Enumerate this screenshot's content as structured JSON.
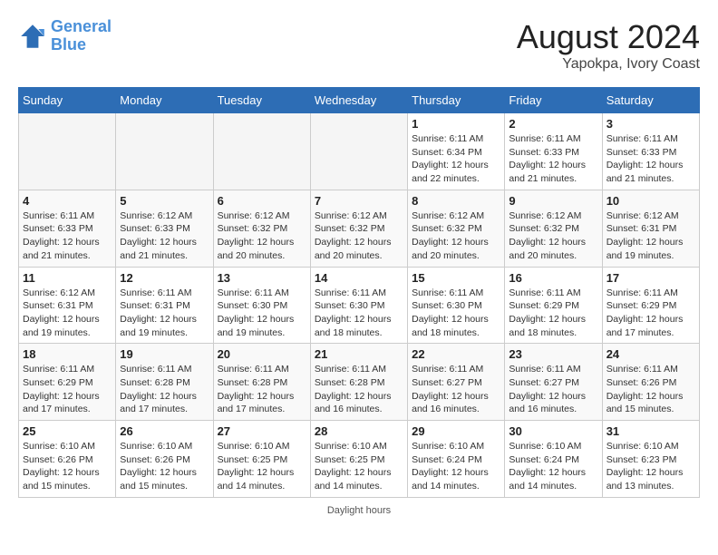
{
  "header": {
    "logo_line1": "General",
    "logo_line2": "Blue",
    "month": "August 2024",
    "location": "Yapokpa, Ivory Coast"
  },
  "days_of_week": [
    "Sunday",
    "Monday",
    "Tuesday",
    "Wednesday",
    "Thursday",
    "Friday",
    "Saturday"
  ],
  "weeks": [
    [
      {
        "day": "",
        "info": ""
      },
      {
        "day": "",
        "info": ""
      },
      {
        "day": "",
        "info": ""
      },
      {
        "day": "",
        "info": ""
      },
      {
        "day": "1",
        "info": "Sunrise: 6:11 AM\nSunset: 6:34 PM\nDaylight: 12 hours\nand 22 minutes."
      },
      {
        "day": "2",
        "info": "Sunrise: 6:11 AM\nSunset: 6:33 PM\nDaylight: 12 hours\nand 21 minutes."
      },
      {
        "day": "3",
        "info": "Sunrise: 6:11 AM\nSunset: 6:33 PM\nDaylight: 12 hours\nand 21 minutes."
      }
    ],
    [
      {
        "day": "4",
        "info": "Sunrise: 6:11 AM\nSunset: 6:33 PM\nDaylight: 12 hours\nand 21 minutes."
      },
      {
        "day": "5",
        "info": "Sunrise: 6:12 AM\nSunset: 6:33 PM\nDaylight: 12 hours\nand 21 minutes."
      },
      {
        "day": "6",
        "info": "Sunrise: 6:12 AM\nSunset: 6:32 PM\nDaylight: 12 hours\nand 20 minutes."
      },
      {
        "day": "7",
        "info": "Sunrise: 6:12 AM\nSunset: 6:32 PM\nDaylight: 12 hours\nand 20 minutes."
      },
      {
        "day": "8",
        "info": "Sunrise: 6:12 AM\nSunset: 6:32 PM\nDaylight: 12 hours\nand 20 minutes."
      },
      {
        "day": "9",
        "info": "Sunrise: 6:12 AM\nSunset: 6:32 PM\nDaylight: 12 hours\nand 20 minutes."
      },
      {
        "day": "10",
        "info": "Sunrise: 6:12 AM\nSunset: 6:31 PM\nDaylight: 12 hours\nand 19 minutes."
      }
    ],
    [
      {
        "day": "11",
        "info": "Sunrise: 6:12 AM\nSunset: 6:31 PM\nDaylight: 12 hours\nand 19 minutes."
      },
      {
        "day": "12",
        "info": "Sunrise: 6:11 AM\nSunset: 6:31 PM\nDaylight: 12 hours\nand 19 minutes."
      },
      {
        "day": "13",
        "info": "Sunrise: 6:11 AM\nSunset: 6:30 PM\nDaylight: 12 hours\nand 19 minutes."
      },
      {
        "day": "14",
        "info": "Sunrise: 6:11 AM\nSunset: 6:30 PM\nDaylight: 12 hours\nand 18 minutes."
      },
      {
        "day": "15",
        "info": "Sunrise: 6:11 AM\nSunset: 6:30 PM\nDaylight: 12 hours\nand 18 minutes."
      },
      {
        "day": "16",
        "info": "Sunrise: 6:11 AM\nSunset: 6:29 PM\nDaylight: 12 hours\nand 18 minutes."
      },
      {
        "day": "17",
        "info": "Sunrise: 6:11 AM\nSunset: 6:29 PM\nDaylight: 12 hours\nand 17 minutes."
      }
    ],
    [
      {
        "day": "18",
        "info": "Sunrise: 6:11 AM\nSunset: 6:29 PM\nDaylight: 12 hours\nand 17 minutes."
      },
      {
        "day": "19",
        "info": "Sunrise: 6:11 AM\nSunset: 6:28 PM\nDaylight: 12 hours\nand 17 minutes."
      },
      {
        "day": "20",
        "info": "Sunrise: 6:11 AM\nSunset: 6:28 PM\nDaylight: 12 hours\nand 17 minutes."
      },
      {
        "day": "21",
        "info": "Sunrise: 6:11 AM\nSunset: 6:28 PM\nDaylight: 12 hours\nand 16 minutes."
      },
      {
        "day": "22",
        "info": "Sunrise: 6:11 AM\nSunset: 6:27 PM\nDaylight: 12 hours\nand 16 minutes."
      },
      {
        "day": "23",
        "info": "Sunrise: 6:11 AM\nSunset: 6:27 PM\nDaylight: 12 hours\nand 16 minutes."
      },
      {
        "day": "24",
        "info": "Sunrise: 6:11 AM\nSunset: 6:26 PM\nDaylight: 12 hours\nand 15 minutes."
      }
    ],
    [
      {
        "day": "25",
        "info": "Sunrise: 6:10 AM\nSunset: 6:26 PM\nDaylight: 12 hours\nand 15 minutes."
      },
      {
        "day": "26",
        "info": "Sunrise: 6:10 AM\nSunset: 6:26 PM\nDaylight: 12 hours\nand 15 minutes."
      },
      {
        "day": "27",
        "info": "Sunrise: 6:10 AM\nSunset: 6:25 PM\nDaylight: 12 hours\nand 14 minutes."
      },
      {
        "day": "28",
        "info": "Sunrise: 6:10 AM\nSunset: 6:25 PM\nDaylight: 12 hours\nand 14 minutes."
      },
      {
        "day": "29",
        "info": "Sunrise: 6:10 AM\nSunset: 6:24 PM\nDaylight: 12 hours\nand 14 minutes."
      },
      {
        "day": "30",
        "info": "Sunrise: 6:10 AM\nSunset: 6:24 PM\nDaylight: 12 hours\nand 14 minutes."
      },
      {
        "day": "31",
        "info": "Sunrise: 6:10 AM\nSunset: 6:23 PM\nDaylight: 12 hours\nand 13 minutes."
      }
    ]
  ],
  "footer": "Daylight hours"
}
